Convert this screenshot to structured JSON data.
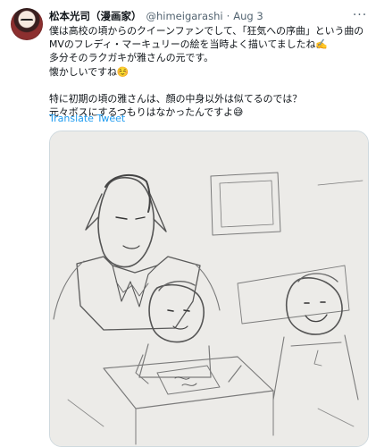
{
  "tweet": {
    "author_name": "松本光司（漫画家）",
    "author_handle": "@himeigarashi",
    "separator": "·",
    "date": "Aug 3",
    "more_label": "···",
    "body_lines": [
      "僕は高校の頃からのクイーンファンでして、「狂気への序曲」という曲の",
      "MVのフレディ・マーキュリーの絵を当時よく描いてましたね✍️",
      "多分そのラクガキが雅さんの元です。",
      "懐かしいですね☺️",
      "",
      "特に初期の頃の雅さんは、顔の中身以外は似てるのでは？",
      "元々ボスにするつもりはなかったんですよ😅"
    ],
    "translate_label": "Translate Tweet",
    "media_description_icon": "pencil-sketch-image"
  }
}
